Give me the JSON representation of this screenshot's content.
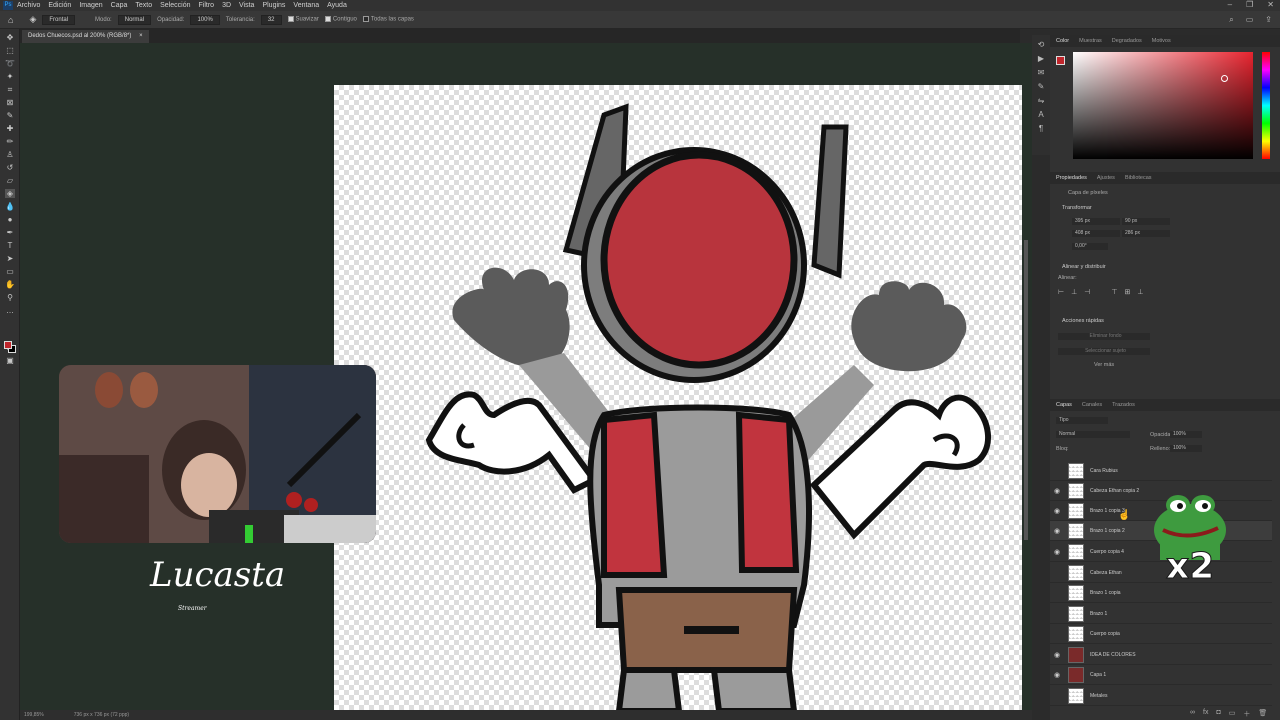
{
  "menu": [
    "Archivo",
    "Edición",
    "Imagen",
    "Capa",
    "Texto",
    "Selección",
    "Filtro",
    "3D",
    "Vista",
    "Plugins",
    "Ventana",
    "Ayuda"
  ],
  "options": {
    "sample_label": "Frontal",
    "mode_label": "Modo:",
    "mode_value": "Normal",
    "opacity_label": "Opacidad:",
    "opacity_value": "100%",
    "tolerance_label": "Tolerancia:",
    "tolerance_value": "32",
    "smooth_label": "Suavizar",
    "contiguous_label": "Contiguo",
    "all_layers_label": "Todas las capas"
  },
  "document": {
    "tab_title": "Dedos Chuecos.psd al 200% (RGB/8*)"
  },
  "status": {
    "zoom": "199,85%",
    "size": "736 px x 736 px (72 ppp)"
  },
  "overlay": {
    "brand": "Lucasta",
    "brand_sub": "Streamer",
    "multiplier": "x2"
  },
  "color_panel": {
    "tabs": [
      "Color",
      "Muestras",
      "Degradados",
      "Motivos"
    ],
    "foreground": "#c0262c",
    "background": "#000000"
  },
  "properties_panel": {
    "tabs": [
      "Propiedades",
      "Ajustes",
      "Bibliotecas"
    ],
    "layer_kind": "Capa de píxeles",
    "transform_title": "Transformar",
    "w": "395 px",
    "x": "90 px",
    "h": "408 px",
    "y": "286 px",
    "angle": "0,00°",
    "align_title": "Alinear y distribuir",
    "align_label": "Alinear:",
    "quick_actions_title": "Acciones rápidas",
    "remove_bg": "Eliminar fondo",
    "select_subject": "Seleccionar sujeto",
    "more": "Ver más"
  },
  "layers_panel": {
    "tabs": [
      "Capas",
      "Canales",
      "Trazados"
    ],
    "filter": "Tipo",
    "blend": "Normal",
    "opacity_label": "Opacidad:",
    "opacity_value": "100%",
    "lock_label": "Bloq:",
    "fill_label": "Relleno:",
    "fill_value": "100%",
    "layers": [
      {
        "name": "Cara Rubius",
        "visible": false
      },
      {
        "name": "Cabeza Ethan copia 2",
        "visible": true
      },
      {
        "name": "Brazo 1 copia 3",
        "visible": true
      },
      {
        "name": "Brazo 1 copia 2",
        "visible": true,
        "selected": true
      },
      {
        "name": "Cuerpo copia 4",
        "visible": true
      },
      {
        "name": "Cabeza Ethan",
        "visible": false
      },
      {
        "name": "Brazo 1 copia",
        "visible": false
      },
      {
        "name": "Brazo 1",
        "visible": false
      },
      {
        "name": "Cuerpo copia",
        "visible": false
      },
      {
        "name": "IDEA DE COLORES",
        "visible": true
      },
      {
        "name": "Capa 1",
        "visible": true
      },
      {
        "name": "Metales",
        "visible": false
      }
    ]
  }
}
